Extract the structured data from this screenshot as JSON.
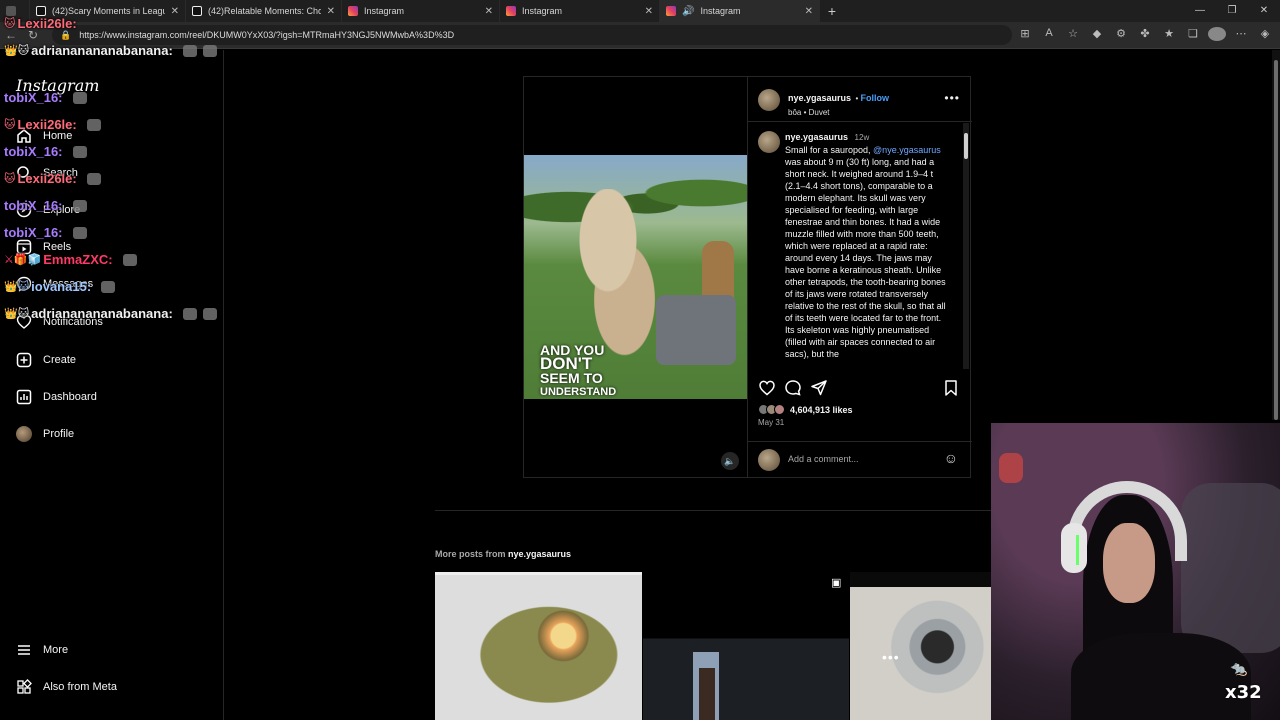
{
  "tabs": [
    {
      "label": "(42)Scary Moments in League of",
      "icon": "tiktok-icon"
    },
    {
      "label": "(42)Relatable Moments: Choosing",
      "icon": "tiktok-icon"
    },
    {
      "label": "Instagram",
      "icon": "instagram-icon"
    },
    {
      "label": "Instagram",
      "icon": "instagram-icon"
    },
    {
      "label": "Instagram",
      "icon": "instagram-icon"
    }
  ],
  "url": "https://www.instagram.com/reel/DKUMW0YxX03/?igsh=MTRmaHY3NGJ5NWMwbA%3D%3D",
  "sidebar": {
    "logo": "Instagram",
    "items": [
      {
        "label": "Home",
        "icon": "home-icon"
      },
      {
        "label": "Search",
        "icon": "search-icon"
      },
      {
        "label": "Explore",
        "icon": "explore-icon"
      },
      {
        "label": "Reels",
        "icon": "reels-icon"
      },
      {
        "label": "Messages",
        "icon": "messages-icon"
      },
      {
        "label": "Notifications",
        "icon": "heart-icon"
      },
      {
        "label": "Create",
        "icon": "plus-icon"
      },
      {
        "label": "Dashboard",
        "icon": "dashboard-icon"
      },
      {
        "label": "Profile",
        "icon": "profile-icon"
      }
    ],
    "more": "More",
    "meta": "Also from Meta"
  },
  "chat": [
    {
      "name": "Lexii26le:",
      "badge": "🐱"
    },
    {
      "name": "adriananananabanana:",
      "badge": "👑🐱"
    },
    {
      "name": "tobiX_16:",
      "badge": ""
    },
    {
      "name": "Lexii26le:",
      "badge": "🐱"
    },
    {
      "name": "tobiX_16:",
      "badge": ""
    },
    {
      "name": "Lexii26le:",
      "badge": "🐱"
    },
    {
      "name": "tobiX_16:",
      "badge": ""
    },
    {
      "name": "tobiX_16:",
      "badge": ""
    },
    {
      "name": "EmmaZXC:",
      "badge": "⚔🎁🧊"
    },
    {
      "name": "iovana15:",
      "badge": "👑🐱"
    },
    {
      "name": "adriananananabanana:",
      "badge": "👑🐱"
    }
  ],
  "post": {
    "video_text": [
      "AND YOU",
      "DON'T",
      "SEEM TO",
      "UNDERSTAND"
    ],
    "author": "nye.ygasaurus",
    "follow": "Follow",
    "audio": "bôa • Duvet",
    "caption_author": "nye.ygasaurus",
    "caption_age": "12w",
    "caption_pre": "Small for a sauropod, ",
    "caption_mention": "@nye.ygasaurus",
    "caption_post": " was about 9 m (30 ft) long, and had a short neck. It weighed around 1.9–4 t (2.1–4.4 short tons), comparable to a modern elephant. Its skull was very specialised for feeding, with large fenestrae and thin bones. It had a wide muzzle filled with more than 500 teeth, which were replaced at a rapid rate: around every 14 days. The jaws may have borne a keratinous sheath. Unlike other tetrapods, the tooth-bearing bones of its jaws were rotated transversely relative to the rest of the skull, so that all of its teeth were located far to the front. Its skeleton was highly pneumatised (filled with air spaces connected to air sacs), but the",
    "likes": "4,604,913 likes",
    "date": "May 31",
    "comment_placeholder": "Add a comment..."
  },
  "more_posts": {
    "label": "More posts from ",
    "author": "nye.ygasaurus"
  },
  "overlay": {
    "counter": "x32"
  }
}
